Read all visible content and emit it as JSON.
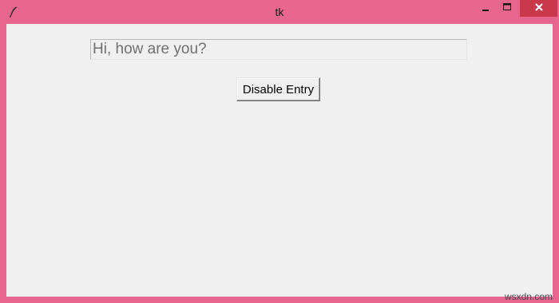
{
  "window": {
    "title": "tk",
    "icons": {
      "app": "feather-icon",
      "minimize": "minimize-icon",
      "maximize": "maximize-icon",
      "close": "close-icon"
    },
    "colors": {
      "frame": "#e6668f",
      "close": "#c9394b",
      "client": "#f0f0f0"
    }
  },
  "form": {
    "entry_value": "Hi, how are you?",
    "button_label": "Disable Entry"
  },
  "watermark": "wsxdn.com"
}
